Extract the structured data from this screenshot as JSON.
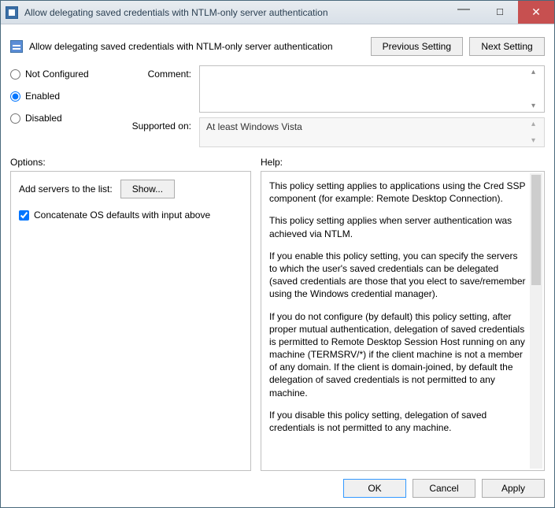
{
  "window": {
    "title": "Allow delegating saved credentials with NTLM-only server authentication"
  },
  "header": {
    "heading": "Allow delegating saved credentials with NTLM-only server authentication",
    "previous_button": "Previous Setting",
    "next_button": "Next Setting"
  },
  "state": {
    "not_configured_label": "Not Configured",
    "enabled_label": "Enabled",
    "disabled_label": "Disabled",
    "selected": "enabled"
  },
  "comment": {
    "label": "Comment:",
    "value": ""
  },
  "supported": {
    "label": "Supported on:",
    "value": "At least Windows Vista"
  },
  "sections": {
    "options_label": "Options:",
    "help_label": "Help:"
  },
  "options": {
    "add_servers_label": "Add servers to the list:",
    "show_button": "Show...",
    "concat_label": "Concatenate OS defaults with input above",
    "concat_checked": true
  },
  "help": {
    "p1": "This policy setting applies to applications using the Cred SSP component (for example: Remote Desktop Connection).",
    "p2": "This policy setting applies when server authentication was achieved via NTLM.",
    "p3": "If you enable this policy setting, you can specify the servers to which the user's saved credentials can be delegated (saved credentials are those that you elect to save/remember using the Windows credential manager).",
    "p4": "If you do not configure (by default) this policy setting, after proper mutual authentication, delegation of saved credentials is permitted to Remote Desktop Session Host running on any machine (TERMSRV/*) if the client machine is not a member of any domain. If the client is domain-joined, by default the delegation of saved credentials is not permitted to any machine.",
    "p5": "If you disable this policy setting, delegation of saved credentials is not permitted to any machine."
  },
  "footer": {
    "ok": "OK",
    "cancel": "Cancel",
    "apply": "Apply"
  }
}
